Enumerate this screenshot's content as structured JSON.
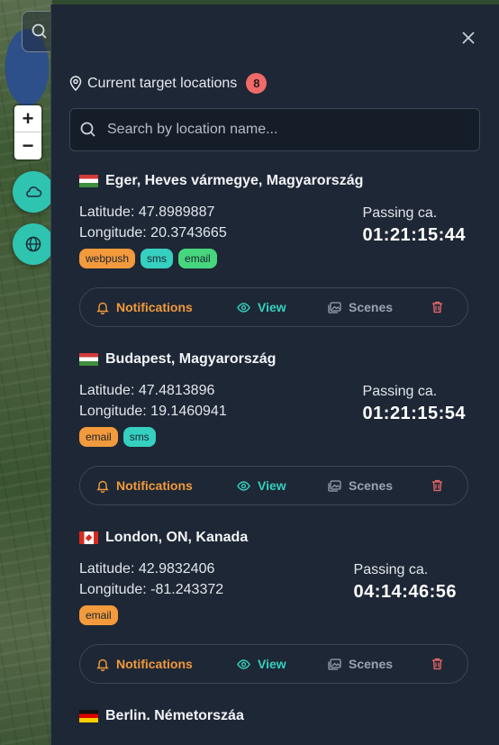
{
  "map": {
    "zoom_in_label": "+",
    "zoom_out_label": "−"
  },
  "panel": {
    "title": "Current target locations",
    "count": "8",
    "search_placeholder": "Search by location name...",
    "passing_label": "Passing ca.",
    "latitude_prefix": "Latitude:",
    "longitude_prefix": "Longitude:",
    "actions": {
      "notifications": "Notifications",
      "view": "View",
      "scenes": "Scenes"
    }
  },
  "locations": [
    {
      "name": "Eger, Heves vármegye, Magyarország",
      "flag": "hu",
      "latitude": "Latitude: 47.8989887",
      "longitude": "Longitude: 20.3743665",
      "passing_time": "01:21:15:44",
      "tags": [
        "webpush",
        "sms",
        "email"
      ]
    },
    {
      "name": "Budapest, Magyarország",
      "flag": "hu",
      "latitude": "Latitude: 47.4813896",
      "longitude": "Longitude: 19.1460941",
      "passing_time": "01:21:15:54",
      "tags": [
        "email",
        "sms"
      ]
    },
    {
      "name": "London, ON, Kanada",
      "flag": "ca",
      "latitude": "Latitude: 42.9832406",
      "longitude": "Longitude: -81.243372",
      "passing_time": "04:14:46:56",
      "tags": [
        "email"
      ]
    },
    {
      "name": "Berlin. Németorszáa",
      "flag": "de"
    }
  ],
  "colors": {
    "panel_bg": "#1e2735",
    "accent_teal": "#36d0c0",
    "accent_orange": "#f29a3c",
    "badge_red": "#f06a6a",
    "delete_red": "#f06a6a"
  }
}
